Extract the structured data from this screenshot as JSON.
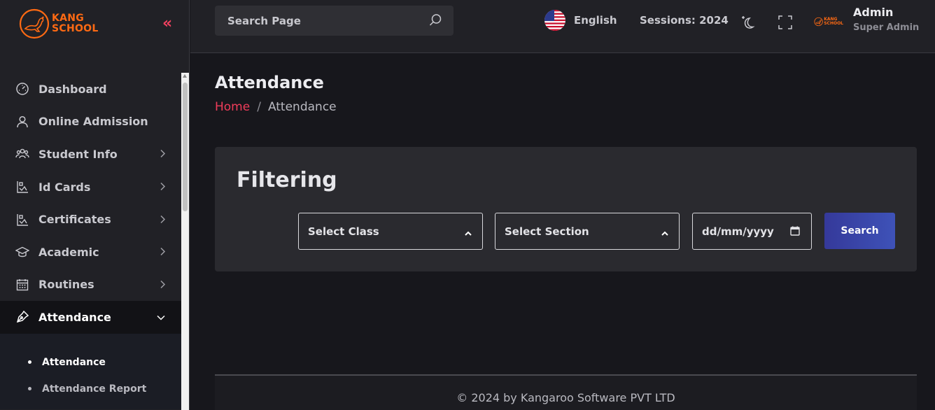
{
  "brand": {
    "line1": "KANG",
    "line2": "SCHOOL",
    "color": "#ff6a13"
  },
  "sidebar": {
    "collapse_label": "«",
    "items": [
      {
        "label": "Dashboard",
        "icon": "dashboard-gauge-icon"
      },
      {
        "label": "Online Admission",
        "icon": "user-icon"
      },
      {
        "label": "Student Info",
        "icon": "students-group-icon"
      },
      {
        "label": "Id Cards",
        "icon": "id-card-icon"
      },
      {
        "label": "Certificates",
        "icon": "certificate-icon"
      },
      {
        "label": "Academic",
        "icon": "graduation-cap-icon"
      },
      {
        "label": "Routines",
        "icon": "calendar-icon"
      },
      {
        "label": "Attendance",
        "icon": "pen-nib-icon",
        "active": true
      }
    ],
    "submenu": [
      {
        "label": "Attendance",
        "active": true
      },
      {
        "label": "Attendance Report"
      }
    ]
  },
  "header": {
    "search_placeholder": "Search Page",
    "language": "English",
    "session": "Sessions: 2024",
    "user": {
      "name": "Admin",
      "role": "Super Admin"
    },
    "avatar_text": {
      "line1": "KANG",
      "line2": "SCHOOL"
    }
  },
  "page": {
    "title": "Attendance",
    "breadcrumb": {
      "home": "Home",
      "separator": "/",
      "current": "Attendance"
    }
  },
  "filter": {
    "title": "Filtering",
    "class_placeholder": "Select Class",
    "section_placeholder": "Select Section",
    "date_placeholder": "dd/mm/yyyy",
    "search_label": "Search"
  },
  "footer": {
    "text": "© 2024 by Kangaroo Software PVT LTD"
  },
  "colors": {
    "accent": "#f03c5a",
    "primary_button": "#3a43a8",
    "background": "#17171c",
    "panel": "#2a2a2f"
  }
}
